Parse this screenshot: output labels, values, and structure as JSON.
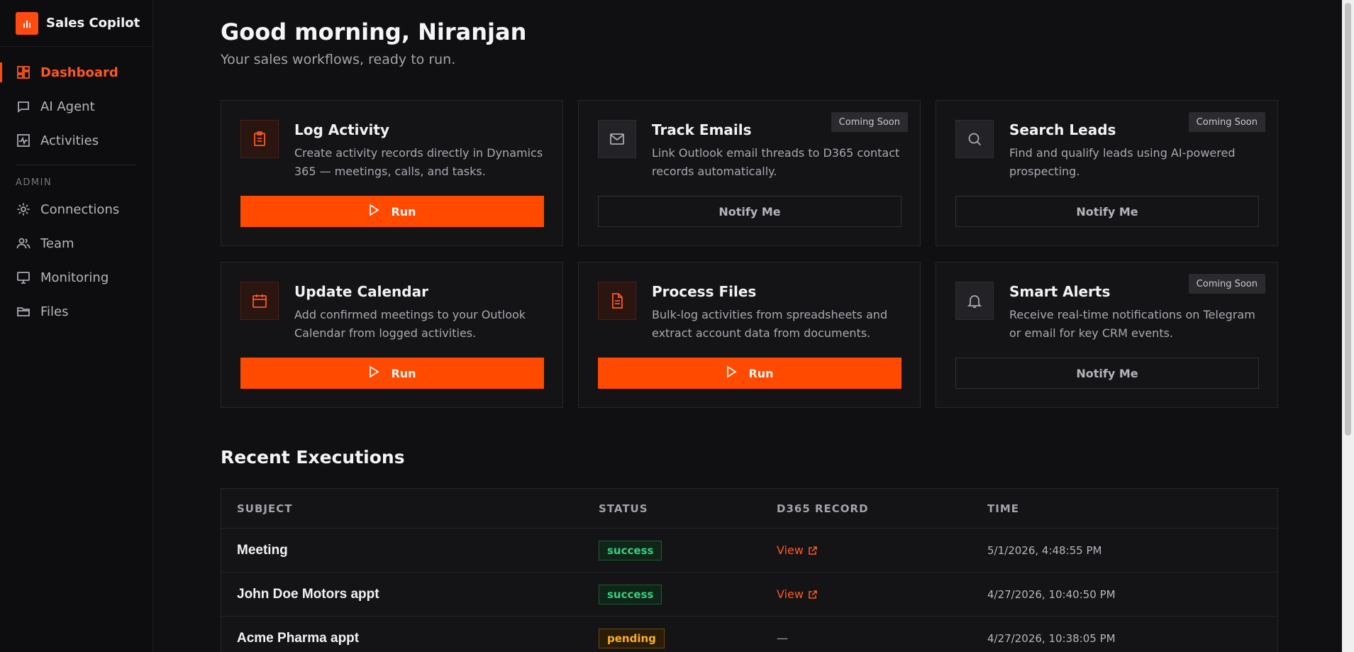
{
  "app": {
    "name": "Sales Copilot"
  },
  "sidebar": {
    "items": [
      {
        "label": "Dashboard",
        "icon": "dashboard-icon"
      },
      {
        "label": "AI Agent",
        "icon": "chat-icon"
      },
      {
        "label": "Activities",
        "icon": "activity-icon"
      }
    ],
    "admin_label": "ADMIN",
    "admin_items": [
      {
        "label": "Connections",
        "icon": "gear-icon"
      },
      {
        "label": "Team",
        "icon": "users-icon"
      },
      {
        "label": "Monitoring",
        "icon": "monitor-icon"
      },
      {
        "label": "Files",
        "icon": "folder-icon"
      }
    ]
  },
  "header": {
    "greeting": "Good morning, Niranjan",
    "subtitle": "Your sales workflows, ready to run."
  },
  "cards": [
    {
      "title": "Log Activity",
      "desc": "Create activity records directly in Dynamics 365 — meetings, calls, and tasks.",
      "action": "Run",
      "icon": "clipboard-icon"
    },
    {
      "title": "Track Emails",
      "desc": "Link Outlook email threads to D365 contact records automatically.",
      "action": "Notify Me",
      "badge": "Coming Soon",
      "icon": "mail-icon"
    },
    {
      "title": "Search Leads",
      "desc": "Find and qualify leads using AI-powered prospecting.",
      "action": "Notify Me",
      "badge": "Coming Soon",
      "icon": "search-icon"
    },
    {
      "title": "Update Calendar",
      "desc": "Add confirmed meetings to your Outlook Calendar from logged activities.",
      "action": "Run",
      "icon": "calendar-icon"
    },
    {
      "title": "Process Files",
      "desc": "Bulk-log activities from spreadsheets and extract account data from documents.",
      "action": "Run",
      "icon": "file-text-icon"
    },
    {
      "title": "Smart Alerts",
      "desc": "Receive real-time notifications on Telegram or email for key CRM events.",
      "action": "Notify Me",
      "badge": "Coming Soon",
      "icon": "bell-icon"
    }
  ],
  "recent": {
    "title": "Recent Executions",
    "columns": [
      "SUBJECT",
      "STATUS",
      "D365 RECORD",
      "TIME"
    ],
    "rows": [
      {
        "subject": "Meeting",
        "status": "success",
        "record": "View",
        "time": "5/1/2026, 4:48:55 PM"
      },
      {
        "subject": "John Doe Motors appt",
        "status": "success",
        "record": "View",
        "time": "4/27/2026, 10:40:50 PM"
      },
      {
        "subject": "Acme Pharma appt",
        "status": "pending",
        "record": "—",
        "time": "4/27/2026, 10:38:05 PM"
      }
    ]
  },
  "colors": {
    "accent": "#ff4a00",
    "success": "#35d07f",
    "pending": "#ffb020",
    "background": "#101012"
  }
}
